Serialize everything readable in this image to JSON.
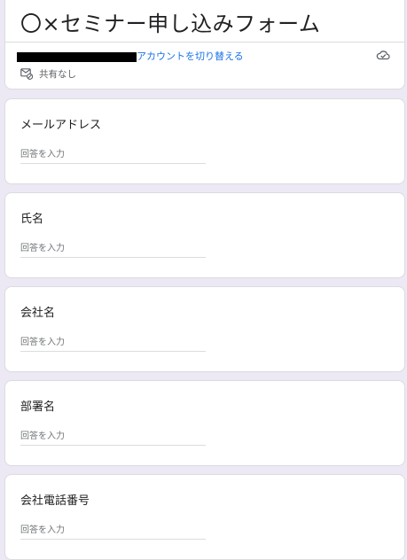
{
  "form": {
    "title": "〇×セミナー申し込みフォーム",
    "switch_account_label": "アカウントを切り替える",
    "share_status": "共有なし",
    "icons": {
      "cloud": "cloud-saved-icon",
      "share": "not-shared-icon"
    }
  },
  "questions": [
    {
      "label": "メールアドレス",
      "placeholder": "回答を入力"
    },
    {
      "label": "氏名",
      "placeholder": "回答を入力"
    },
    {
      "label": "会社名",
      "placeholder": "回答を入力"
    },
    {
      "label": "部署名",
      "placeholder": "回答を入力"
    },
    {
      "label": "会社電話番号",
      "placeholder": "回答を入力"
    }
  ],
  "colors": {
    "background": "#ece8f4",
    "link": "#1a73e8"
  }
}
